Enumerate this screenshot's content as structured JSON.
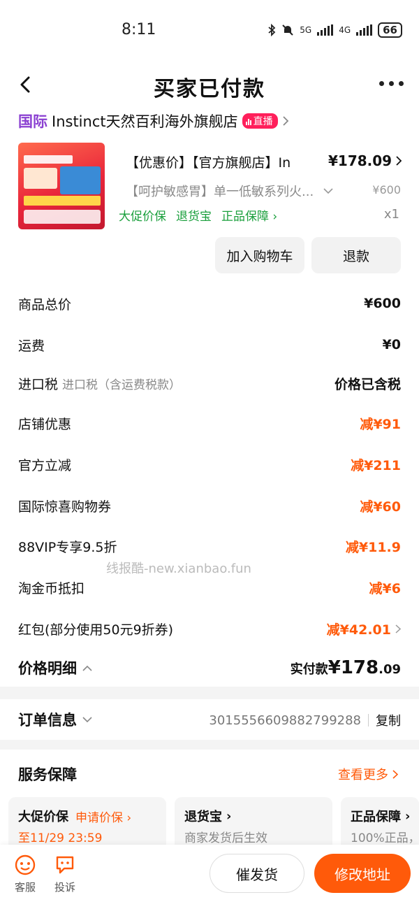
{
  "status_bar": {
    "time": "8:11",
    "network_1": "5G",
    "network_2": "4G",
    "battery": "66"
  },
  "header": {
    "title": "买家已付款"
  },
  "store": {
    "tag": "国际",
    "name": "Instinct天然百利海外旗舰店",
    "live_label": "直播"
  },
  "product": {
    "title": "【优惠价】【官方旗舰店】In",
    "price": "¥178.09",
    "sku": "【呵护敏感胃】单一低敏系列火...",
    "original_price": "¥600",
    "guarantees": [
      "大促价保",
      "退货宝",
      "正品保障"
    ],
    "quantity": "x1"
  },
  "actions": {
    "add_to_cart": "加入购物车",
    "refund": "退款"
  },
  "fees": [
    {
      "label": "商品总价",
      "note": "",
      "value": "¥600",
      "discount": false
    },
    {
      "label": "运费",
      "note": "",
      "value": "¥0",
      "discount": false
    },
    {
      "label": "进口税",
      "note": "进口税（含运费税款）",
      "value": "价格已含税",
      "discount": false
    },
    {
      "label": "店铺优惠",
      "note": "",
      "value": "减¥91",
      "discount": true
    },
    {
      "label": "官方立减",
      "note": "",
      "value": "减¥211",
      "discount": true
    },
    {
      "label": "国际惊喜购物券",
      "note": "",
      "value": "减¥60",
      "discount": true
    },
    {
      "label": "88VIP专享9.5折",
      "note": "",
      "value": "减¥11.9",
      "discount": true
    },
    {
      "label": "淘金币抵扣",
      "note": "",
      "value": "减¥6",
      "discount": true
    },
    {
      "label": "红包(部分使用50元9折券)",
      "note": "",
      "value": "减¥42.01",
      "discount": true
    }
  ],
  "watermark": "线报酷-new.xianbao.fun",
  "total": {
    "label": "价格明细",
    "paid_label": "实付款",
    "paid_int": "¥178",
    "paid_dec": ".09"
  },
  "order": {
    "label": "订单信息",
    "number": "3015556609882799288",
    "copy": "复制"
  },
  "service": {
    "title": "服务保障",
    "more": "查看更多",
    "items": [
      {
        "name": "大促价保",
        "action": "申请价保",
        "sub": "至11/29 23:59"
      },
      {
        "name": "退货宝",
        "action": "",
        "sub": "商家发货后生效"
      },
      {
        "name": "正品保障",
        "action": "",
        "sub": "100%正品，"
      }
    ]
  },
  "bottom": {
    "service": "客服",
    "complain": "投诉",
    "urge": "催发货",
    "modify": "修改地址"
  },
  "colors": {
    "accent": "#ff5a0a",
    "green": "#1a9f3c",
    "purple": "#8a3fd1",
    "live": "#ff1f5b"
  }
}
